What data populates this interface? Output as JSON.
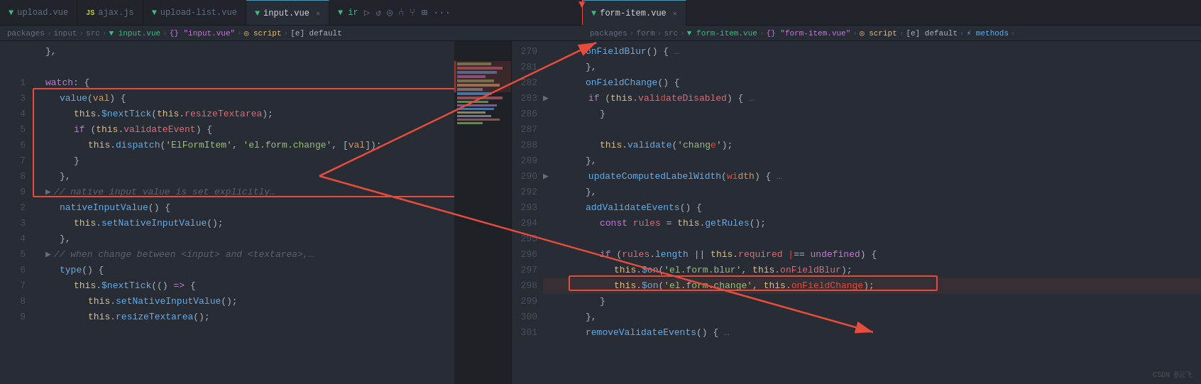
{
  "tabs": {
    "left": [
      {
        "id": "upload-vue",
        "label": "upload.vue",
        "icon": "vue",
        "active": false,
        "closable": false
      },
      {
        "id": "ajax-js",
        "label": "ajax.js",
        "icon": "js",
        "active": false,
        "closable": false
      },
      {
        "id": "upload-list-vue",
        "label": "upload-list.vue",
        "icon": "vue",
        "active": false,
        "closable": false
      },
      {
        "id": "input-vue",
        "label": "input.vue",
        "icon": "vue",
        "active": true,
        "closable": true
      }
    ],
    "right": [
      {
        "id": "form-item-vue",
        "label": "form-item.vue",
        "icon": "vue",
        "active": true,
        "closable": true
      }
    ]
  },
  "breadcrumbs": {
    "left": "packages > input > src > input.vue > {} \"input.vue\" > script > [e] default",
    "right": "packages > form > src > form-item.vue > {} \"form-item.vue\" > script > [e] default > methods >"
  },
  "left_code": {
    "lines": [
      {
        "num": "",
        "content": "  },"
      },
      {
        "num": "",
        "content": ""
      },
      {
        "num": "1",
        "content": "  watch: {"
      },
      {
        "num": "3",
        "content": "    value(val) {"
      },
      {
        "num": "4",
        "content": "      this.$nextTick(this.resizeTextarea);"
      },
      {
        "num": "5",
        "content": "      if (this.validateEvent) {"
      },
      {
        "num": "6",
        "content": "        this.dispatch('ElFormItem', 'el.form.change', [val]);"
      },
      {
        "num": "7",
        "content": "      }"
      },
      {
        "num": "8",
        "content": "    },"
      },
      {
        "num": "9",
        "content": "    > // native input value is set explicitly…"
      },
      {
        "num": "2",
        "content": "    nativeInputValue() {"
      },
      {
        "num": "3",
        "content": "      this.setNativeInputValue();"
      },
      {
        "num": "4",
        "content": "    },"
      },
      {
        "num": "5",
        "content": "    > // when change between <input> and <textarea>,…"
      },
      {
        "num": "6",
        "content": "    type() {"
      },
      {
        "num": "7",
        "content": "      this.$nextTick(() => {"
      },
      {
        "num": "8",
        "content": "        this.setNativeInputValue();"
      },
      {
        "num": "9",
        "content": "        this.resizeTextarea();"
      }
    ]
  },
  "right_code": {
    "lines": [
      {
        "num": "279",
        "content": "        onFieldBlur() { …"
      },
      {
        "num": "281",
        "content": "        },"
      },
      {
        "num": "282",
        "content": "        onFieldChange() {"
      },
      {
        "num": "283",
        "content": "  >       if (this.validateDisabled) { …"
      },
      {
        "num": "286",
        "content": "          }"
      },
      {
        "num": "287",
        "content": ""
      },
      {
        "num": "288",
        "content": "          this.validate('change');"
      },
      {
        "num": "289",
        "content": "        },"
      },
      {
        "num": "290",
        "content": "  >     updateComputedLabelWidth(width) { …"
      },
      {
        "num": "292",
        "content": "        },"
      },
      {
        "num": "293",
        "content": "        addValidateEvents() {"
      },
      {
        "num": "294",
        "content": "          const rules = this.getRules();"
      },
      {
        "num": "295",
        "content": ""
      },
      {
        "num": "296",
        "content": "          if (rules.length || this.required === undefined) {"
      },
      {
        "num": "297",
        "content": "            this.$on('el.form.blur', this.onFieldBlur);"
      },
      {
        "num": "298",
        "content": "            this.$on('el.form.change', this.onFieldChange);"
      },
      {
        "num": "299",
        "content": "          }"
      },
      {
        "num": "300",
        "content": "        },"
      },
      {
        "num": "301",
        "content": "        removeValidateEvents() { …"
      }
    ]
  },
  "colors": {
    "bg_editor": "#282c34",
    "bg_dark": "#21252b",
    "accent_red": "#e74c3c",
    "accent_green": "#42b883",
    "line_highlight": "rgba(231,76,60,0.12)",
    "text_normal": "#abb2bf",
    "line_num": "#495162"
  },
  "watermark": "CSDN @云飞"
}
